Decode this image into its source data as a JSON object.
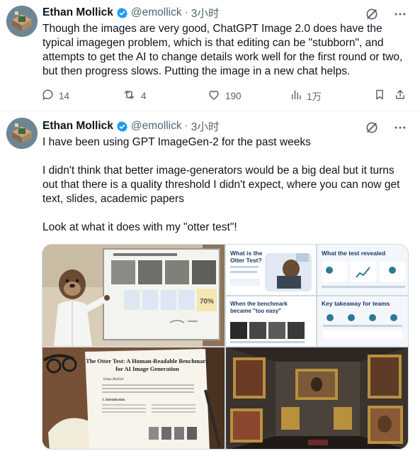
{
  "tweets": [
    {
      "author": {
        "name": "Ethan Mollick",
        "handle": "@emollick",
        "time": "3小时",
        "dot": "·"
      },
      "text": "Though the images are very good, ChatGPT Image 2.0 does have the typical imagegen problem, which is that editing can be \"stubborn\", and attempts to get the AI to change details work well for the first round or two, but then progress slows. Putting the image in a new chat helps.",
      "actions": {
        "replies": "14",
        "reposts": "4",
        "likes": "190",
        "views": "1万"
      }
    },
    {
      "author": {
        "name": "Ethan Mollick",
        "handle": "@emollick",
        "time": "3小时",
        "dot": "·"
      },
      "text": "I have been using GPT ImageGen-2 for the past weeks\n\nI didn't think that better image-generators would be a big deal but it turns out that there is a quality threshold I didn't expect, where you can now get text, slides, academic papers\n\nLook at what it does with my \"otter test\"!",
      "media": {
        "slide_comparison": {
          "result": "70%"
        },
        "slide_otter_test": {
          "title": "What is the Otter Test?"
        },
        "slide_revealed": {
          "title": "What the test revealed"
        },
        "slide_benchmark": {
          "title": "When the benchmark became \"too easy\""
        },
        "slide_takeaway": {
          "title": "Key takeaway for teams"
        },
        "paper": {
          "title": "The Otter Test: A Human-Readable Benchmark for AI Image Generation",
          "author": "Ethan Mollick",
          "section": "1. Introduction"
        }
      }
    }
  ],
  "colors": {
    "verified": "#1d9bf0",
    "muted": "#536471",
    "text": "#0f1419",
    "border": "#eff3f4"
  },
  "icons": [
    "grok-icon",
    "more-icon",
    "verified-badge-icon",
    "reply-icon",
    "repost-icon",
    "like-icon",
    "views-icon",
    "bookmark-icon",
    "share-icon"
  ]
}
